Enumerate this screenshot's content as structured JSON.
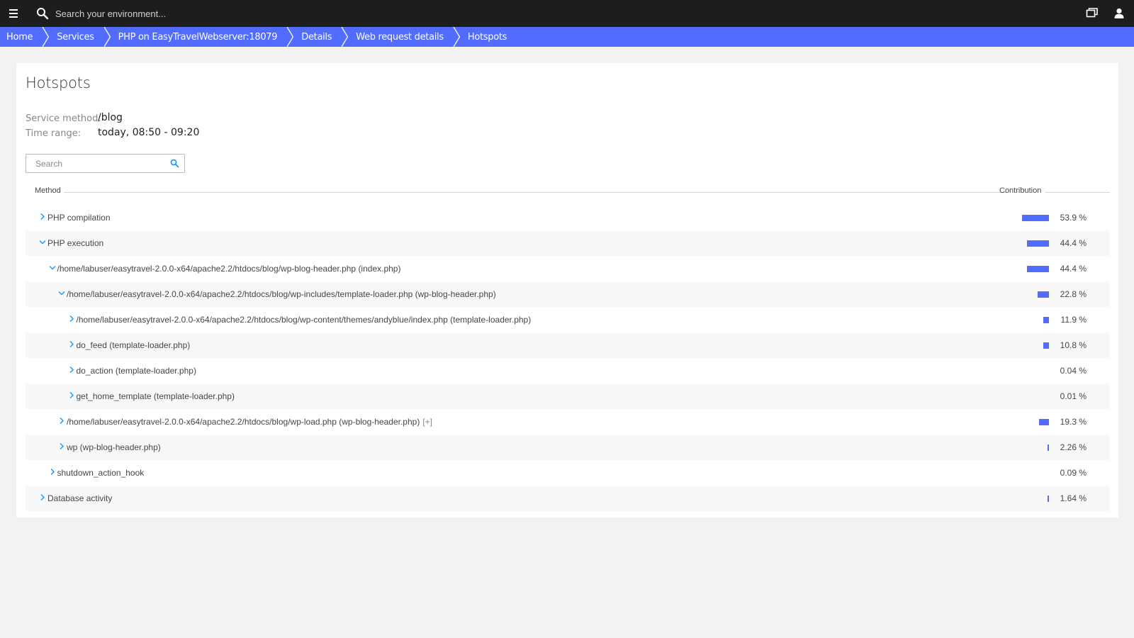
{
  "topbar": {
    "search_placeholder": "Search your environment...",
    "icons": [
      "menu-icon",
      "search-icon",
      "windows-icon",
      "user-icon"
    ]
  },
  "breadcrumb": [
    {
      "label": "Home"
    },
    {
      "label": "Services"
    },
    {
      "label": "PHP on EasyTravelWebserver:18079"
    },
    {
      "label": "Details"
    },
    {
      "label": "Web request details"
    },
    {
      "label": "Hotspots"
    }
  ],
  "page": {
    "title": "Hotspots",
    "service_method_label": "Service method:",
    "service_method_value": "/blog",
    "time_range_label": "Time range:",
    "time_range_value": "today, 08:50 - 09:20",
    "search_placeholder": "Search"
  },
  "table": {
    "columns": {
      "method": "Method",
      "contribution": "Contribution"
    },
    "rows": [
      {
        "label": "PHP compilation",
        "depth": 0,
        "expanded": false,
        "contribution_pct": 53.9,
        "contribution": "53.9 %"
      },
      {
        "label": "PHP execution",
        "depth": 0,
        "expanded": true,
        "contribution_pct": 44.4,
        "contribution": "44.4 %"
      },
      {
        "label": "/home/labuser/easytravel-2.0.0-x64/apache2.2/htdocs/blog/wp-blog-header.php (index.php)",
        "depth": 1,
        "expanded": true,
        "contribution_pct": 44.4,
        "contribution": "44.4 %"
      },
      {
        "label": "/home/labuser/easytravel-2.0.0-x64/apache2.2/htdocs/blog/wp-includes/template-loader.php (wp-blog-header.php)",
        "depth": 2,
        "expanded": true,
        "contribution_pct": 22.8,
        "contribution": "22.8 %"
      },
      {
        "label": "/home/labuser/easytravel-2.0.0-x64/apache2.2/htdocs/blog/wp-content/themes/andyblue/index.php (template-loader.php)",
        "depth": 3,
        "expanded": false,
        "contribution_pct": 11.9,
        "contribution": "11.9 %"
      },
      {
        "label": "do_feed (template-loader.php)",
        "depth": 3,
        "expanded": false,
        "contribution_pct": 10.8,
        "contribution": "10.8 %"
      },
      {
        "label": "do_action (template-loader.php)",
        "depth": 3,
        "expanded": false,
        "contribution_pct": 0.04,
        "contribution": "0.04 %"
      },
      {
        "label": "get_home_template (template-loader.php)",
        "depth": 3,
        "expanded": false,
        "contribution_pct": 0.01,
        "contribution": "0.01 %"
      },
      {
        "label": "/home/labuser/easytravel-2.0.0-x64/apache2.2/htdocs/blog/wp-load.php (wp-blog-header.php)",
        "depth": 2,
        "expanded": false,
        "extra": "[+]",
        "contribution_pct": 19.3,
        "contribution": "19.3 %"
      },
      {
        "label": "wp (wp-blog-header.php)",
        "depth": 2,
        "expanded": false,
        "contribution_pct": 2.26,
        "contribution": "2.26 %"
      },
      {
        "label": "shutdown_action_hook",
        "depth": 1,
        "expanded": false,
        "contribution_pct": 0.09,
        "contribution": "0.09 %"
      },
      {
        "label": "Database activity",
        "depth": 0,
        "expanded": false,
        "contribution_pct": 1.64,
        "contribution": "1.64 %"
      }
    ]
  },
  "colors": {
    "topbar": "#1d1d1d",
    "breadcrumb": "#526cff",
    "bar": "#526cff",
    "background": "#f2f2f2"
  }
}
